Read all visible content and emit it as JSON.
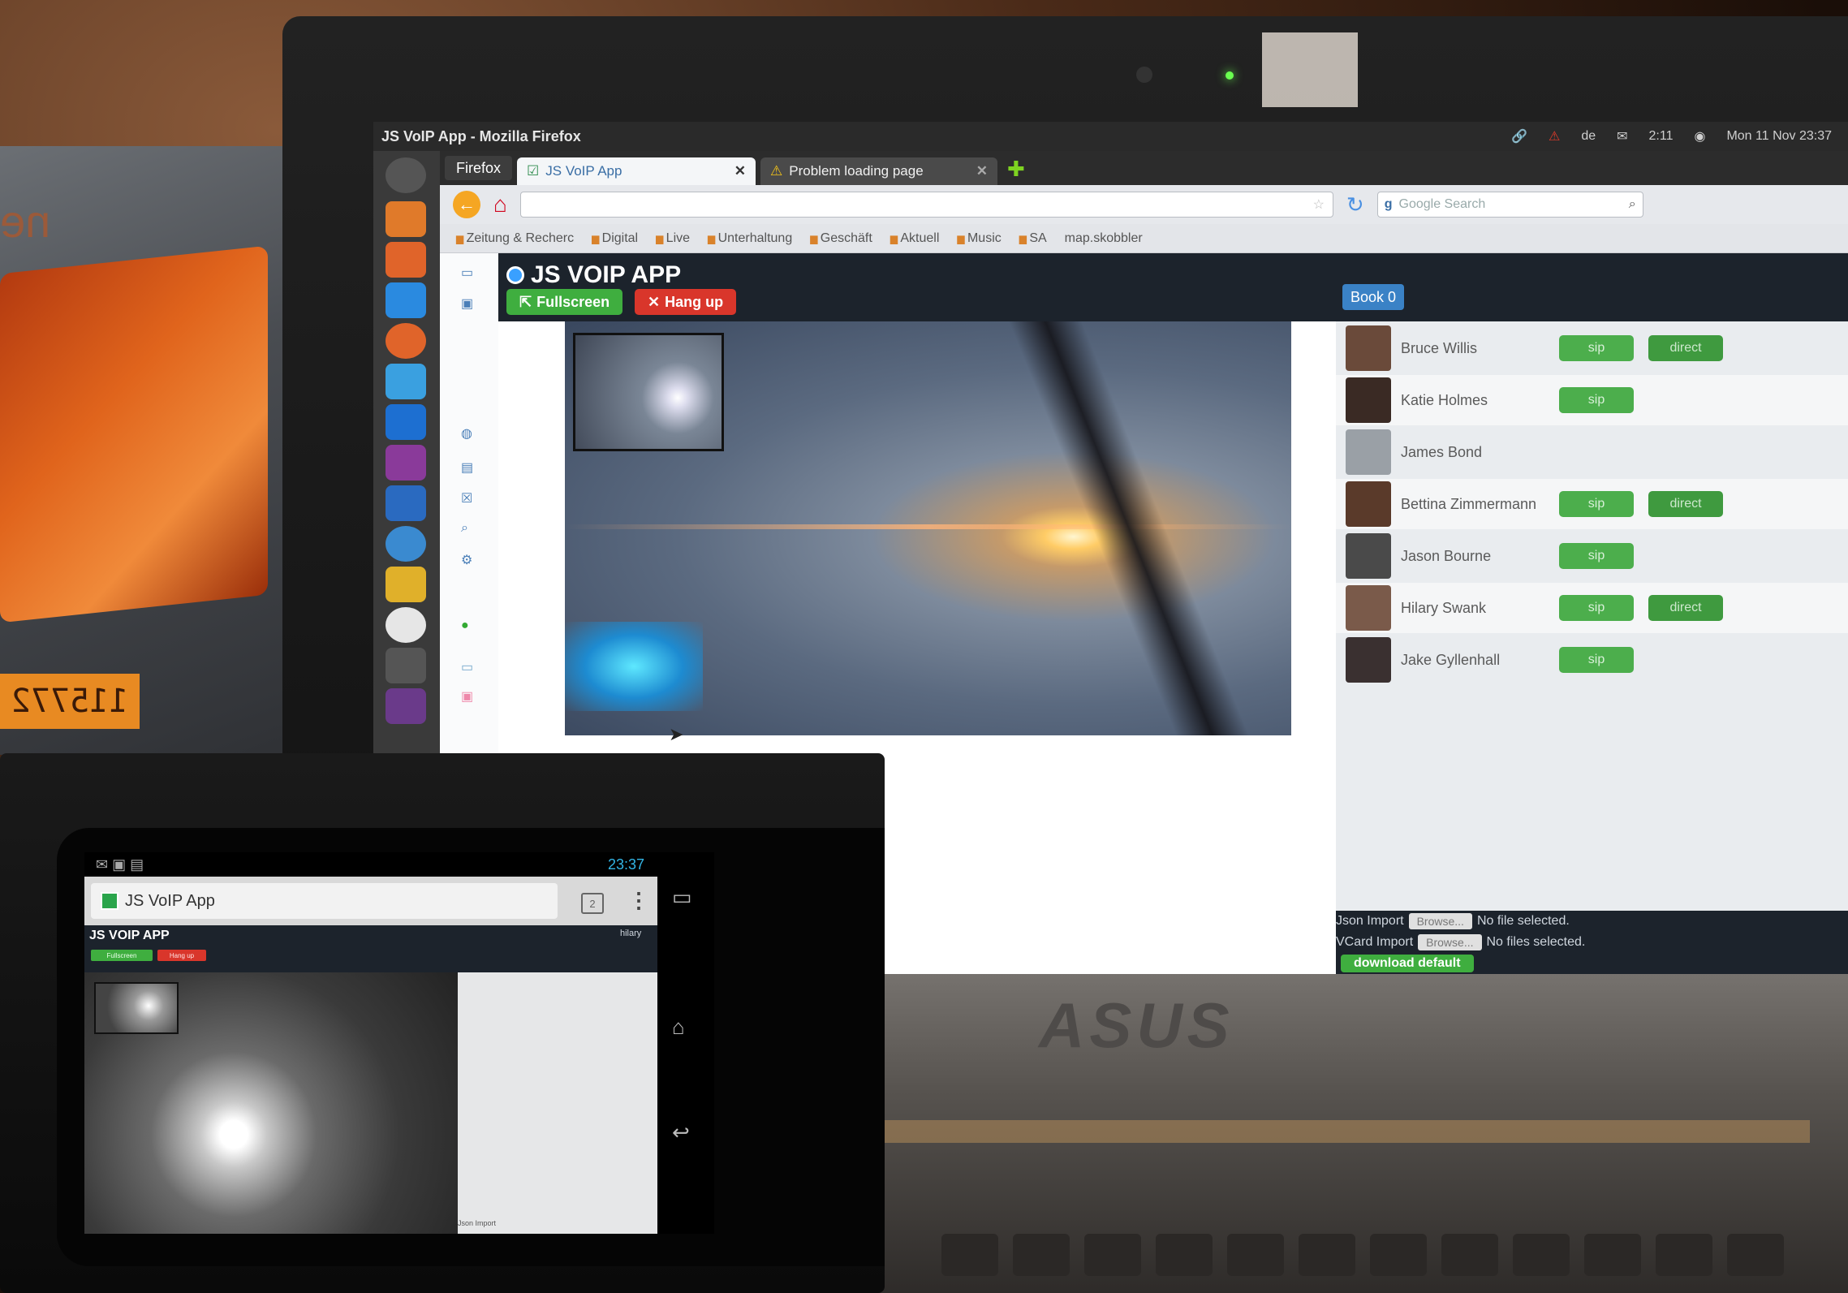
{
  "background": {
    "box_label": "115772"
  },
  "laptop": {
    "brand": "ASUS"
  },
  "os": {
    "window_title": "JS VoIP App - Mozilla Firefox",
    "keyboard_layout": "de",
    "time": "2:11",
    "date": "Mon 11 Nov 23:37"
  },
  "browser": {
    "menu_button": "Firefox",
    "tabs": [
      {
        "label": "JS VoIP App",
        "active": true
      },
      {
        "label": "Problem loading page",
        "active": false
      }
    ],
    "url": "",
    "search_placeholder": "Google Search",
    "bookmarks": [
      "Zeitung & Recherc",
      "Digital",
      "Live",
      "Unterhaltung",
      "Geschäft",
      "Aktuell",
      "Music",
      "SA",
      "map.skobbler"
    ]
  },
  "app": {
    "title": "JS VOIP APP",
    "fullscreen_label": "Fullscreen",
    "hangup_label": "Hang up",
    "book_label": "Book 0",
    "contacts": [
      {
        "name": "Bruce Willis",
        "sip": "sip",
        "direct": "direct",
        "avatar_color": "#6a4a3a"
      },
      {
        "name": "Katie Holmes",
        "sip": "sip",
        "direct": null,
        "avatar_color": "#3a2a24"
      },
      {
        "name": "James Bond",
        "sip": null,
        "direct": null,
        "avatar_color": "#9aa0a6"
      },
      {
        "name": "Bettina Zimmermann",
        "sip": "sip",
        "direct": "direct",
        "avatar_color": "#5a3a2a"
      },
      {
        "name": "Jason Bourne",
        "sip": "sip",
        "direct": null,
        "avatar_color": "#4a4a4a"
      },
      {
        "name": "Hilary Swank",
        "sip": "sip",
        "direct": "direct",
        "avatar_color": "#7a5a4a"
      },
      {
        "name": "Jake Gyllenhall",
        "sip": "sip",
        "direct": null,
        "avatar_color": "#3a3030"
      }
    ],
    "json_import_label": "Json Import",
    "vcard_import_label": "VCard Import",
    "browse_label": "Browse...",
    "no_file_text": "No file selected.",
    "no_files_text": "No files selected.",
    "download_label": "download default"
  },
  "phone": {
    "time": "23:37",
    "url_title": "JS VoIP App",
    "tab_count": "2",
    "app_title": "JS VOIP APP",
    "user": "hilary",
    "fullscreen_label": "Fullscreen",
    "hangup_label": "Hang up",
    "import_label": "Json Import"
  },
  "colors": {
    "sip_green": "#4cae4c",
    "hangup_red": "#d9362b",
    "app_header": "#1c232c",
    "book_blue": "#3a82c6"
  }
}
